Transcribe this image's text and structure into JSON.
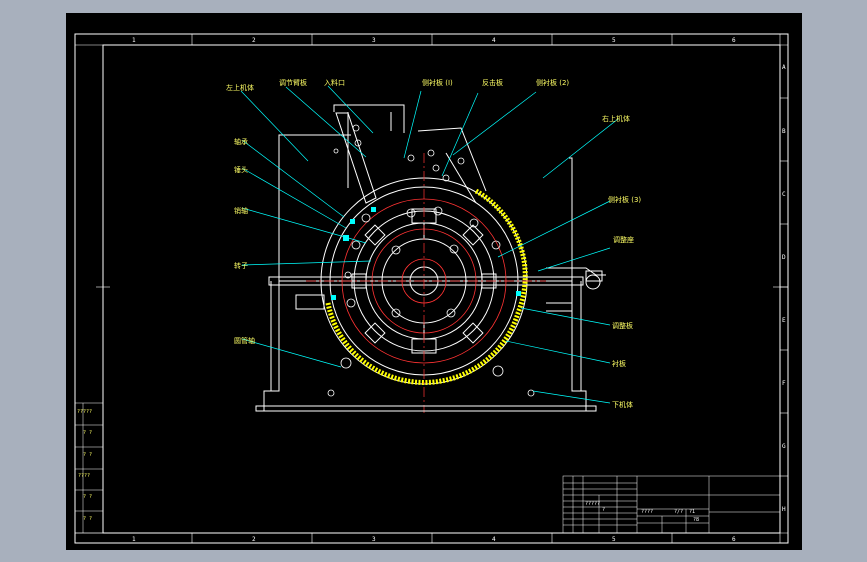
{
  "labels": {
    "a": "左上机体",
    "b": "调节臂板",
    "c": "入料口",
    "d": "侧衬板 (I)",
    "e": "反击板",
    "f": "侧衬板 (2)",
    "g": "右上机体",
    "h": "轴承",
    "i": "锤头",
    "j": "销轴",
    "k": "侧衬板 (3)",
    "l": "调整座",
    "m": "转子",
    "n": "圆管轴",
    "o": "调整板",
    "p": "衬板",
    "q": "下机体"
  },
  "zones": {
    "cols": [
      "1",
      "2",
      "3",
      "4",
      "5",
      "6"
    ],
    "rows": [
      "A",
      "B",
      "C",
      "D",
      "E",
      "F",
      "G",
      "H"
    ]
  },
  "left_strip": [
    "?????",
    "? ?",
    "? ?",
    "????",
    "? ?",
    "? ?"
  ],
  "title_block": [
    "?????",
    "?",
    "????",
    "?/?",
    "?1",
    "?8"
  ],
  "colors": {
    "background": "#000000",
    "frame": "#ffffff",
    "drawing": "#ffffff",
    "leader": "#00ffff",
    "label": "#ffff66",
    "centerline": "#ff3333",
    "hammer_ring": "#ffff00",
    "viewport_outer": "#a8b0bd"
  }
}
